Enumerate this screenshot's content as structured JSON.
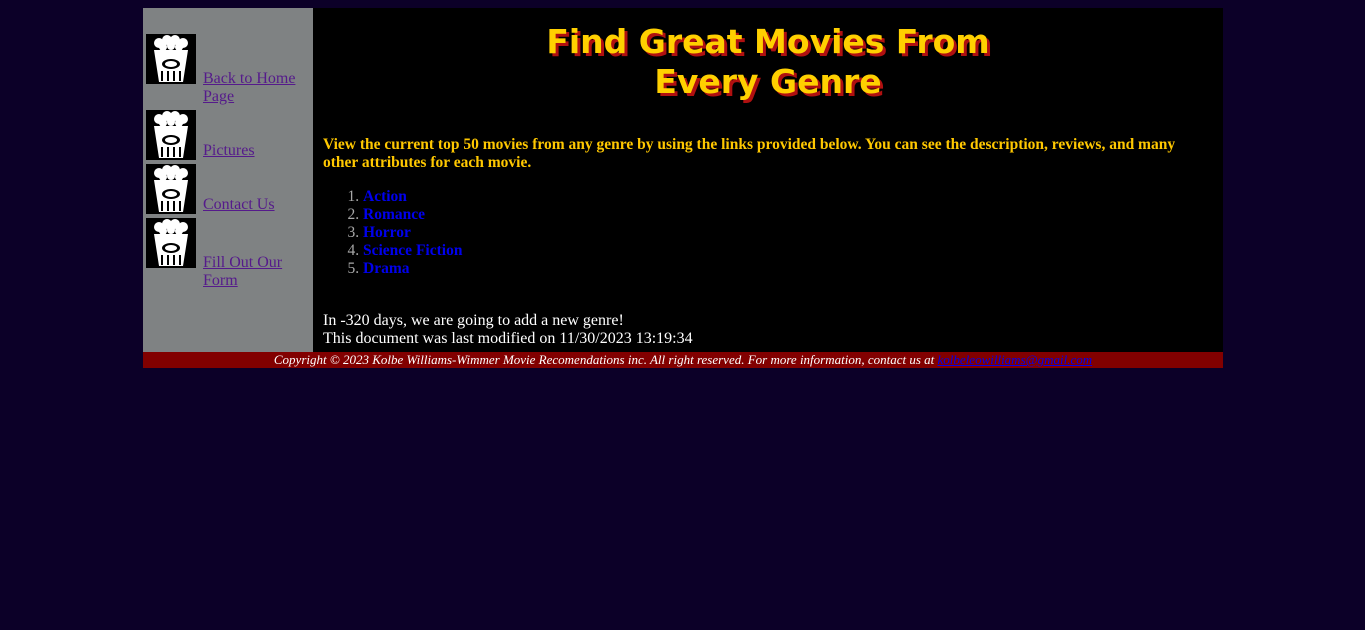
{
  "sidebar": {
    "items": [
      {
        "label": "Back to Home Page",
        "icon": "popcorn-icon"
      },
      {
        "label": "Pictures",
        "icon": "popcorn-icon"
      },
      {
        "label": "Contact Us",
        "icon": "popcorn-icon"
      },
      {
        "label": "Fill Out Our Form",
        "icon": "popcorn-icon"
      }
    ]
  },
  "main": {
    "title_line1": "Find Great Movies From",
    "title_line2": "Every Genre",
    "intro": "View the current top 50 movies from any genre by using the links provided below. You can see the description, reviews, and many other attributes for each movie.",
    "genres": [
      "Action",
      "Romance",
      "Horror",
      "Science Fiction",
      "Drama"
    ],
    "countdown": "In -320 days, we are going to add a new genre!",
    "modified": "This document was last modified on 11/30/2023 13:19:34"
  },
  "footer": {
    "copyright": "Copyright © 2023 Kolbe Williams-Wimmer Movie Recomendations inc. All right reserved. For more information, contact us at ",
    "email": "kolbeleowilliams@gmail.com"
  },
  "colors": {
    "page_bg": "#0c0028",
    "sidebar_bg": "#7f8283",
    "main_bg": "#000000",
    "title": "#ffd000",
    "title_shadow": "#b01010",
    "intro": "#ffc800",
    "link": "#0000ee",
    "visited_link": "#551a8b",
    "footer_bg": "#820000"
  }
}
